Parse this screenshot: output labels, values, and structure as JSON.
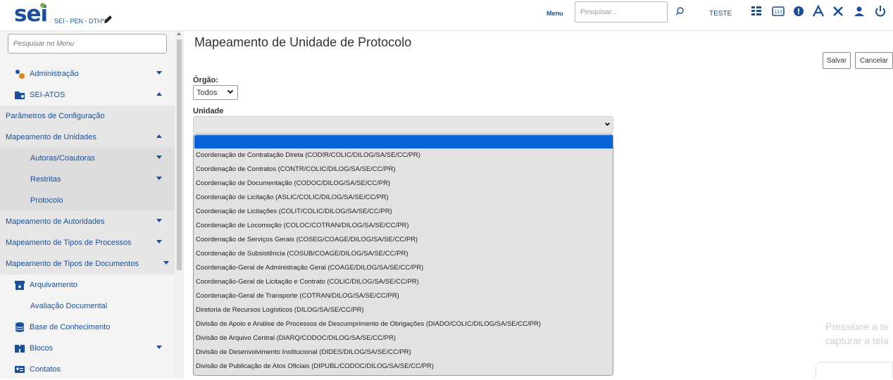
{
  "header": {
    "logo": "sei",
    "org": "SEI - PEN - DTH**",
    "menu_label": "Menu",
    "search_placeholder": "Pesquisar...",
    "user": "TESTE",
    "icons": [
      "control-panel-icon",
      "numeric-icon",
      "gear-badge-icon",
      "font-size-icon",
      "tools-icon",
      "user-icon",
      "power-icon"
    ]
  },
  "sidebar": {
    "search_placeholder": "Pesquisar no Menu",
    "items": [
      {
        "label": "Administração",
        "icon": "gears-icon",
        "caret": "down"
      },
      {
        "label": "SEI-ATOS",
        "icon": "folder-user-icon",
        "caret": "up"
      },
      {
        "label": "Parâmetros de Configuração"
      },
      {
        "label": "Mapeamento de Unidades",
        "caret": "up"
      },
      {
        "label": "Autoras/Coautoras",
        "caret": "down"
      },
      {
        "label": "Restritas",
        "caret": "down"
      },
      {
        "label": "Protocolo"
      },
      {
        "label": "Mapeamento de Autoridades",
        "caret": "down"
      },
      {
        "label": "Mapeamento de Tipos de Processos",
        "caret": "down"
      },
      {
        "label": "Mapeamento de Tipos de Documentos",
        "caret": "down"
      },
      {
        "label": "Arquivamento",
        "icon": "archive-icon"
      },
      {
        "label": "Avaliação Documental"
      },
      {
        "label": "Base de Conhecimento",
        "icon": "database-icon"
      },
      {
        "label": "Blocos",
        "icon": "books-icon",
        "caret": "down"
      },
      {
        "label": "Contatos",
        "icon": "contact-card-icon"
      }
    ]
  },
  "main": {
    "title": "Mapeamento de Unidade de Protocolo",
    "save_label": "Salvar",
    "cancel_label": "Cancelar",
    "orgao_label": "Órgão:",
    "orgao_value": "Todos",
    "unidade_label": "Unidade",
    "unidade_options": [
      "Coordenação de Contratação Direta (CODIR/COLIC/DILOG/SA/SE/CC/PR)",
      "Coordenação de Contratos (CONTR/COLIC/DILOG/SA/SE/CC/PR)",
      "Coordenação de Documentação (CODOC/DILOG/SA/SE/CC/PR)",
      "Coordenação de Licitação (ASLIC/COLIC/DILOG/SA/SE/CC/PR)",
      "Coordenação de Licitações (COLIT/COLIC/DILOG/SA/SE/CC/PR)",
      "Coordenação de Locomoção (COLOC/COTRAN/DILOG/SA/SE/CC/PR)",
      "Coordenação de Serviços Gerais (COSEG/COAGE/DILOG/SA/SE/CC/PR)",
      "Coordenação de Subsistência (COSUB/COAGE/DILOG/SA/SE/CC/PR)",
      "Coordenação-Geral de Administração Geral (COAGE/DILOG/SA/SE/CC/PR)",
      "Coordenação-Geral de Licitação e Contrato (COLIC/DILOG/SA/SE/CC/PR)",
      "Coordenação-Geral de Transporte (COTRAN/DILOG/SA/SE/CC/PR)",
      "Diretoria de Recursos Logísticos (DILOG/SA/SE/CC/PR)",
      "Divisão de Apoio e Análise de Processos de Descumprimento de Obrigações (DIADO/COLIC/DILOG/SA/SE/CC/PR)",
      "Divisão de Arquivo Central (DIARQ/CODOC/DILOG/SA/SE/CC/PR)",
      "Divisão de Desenvolvimento Institucional (DIDES/DILOG/SA/SE/CC/PR)",
      "Divisão de Publicação de Atos Oficiais (DIPUBL/CODOC/DILOG/SA/SE/CC/PR)"
    ]
  },
  "overlay": {
    "line1": "Pressione a te",
    "line2": "capturar a tela"
  },
  "colors": {
    "brand": "#1a4f9c",
    "selected": "#0a64d8",
    "logo_dot": "#7cb342"
  }
}
